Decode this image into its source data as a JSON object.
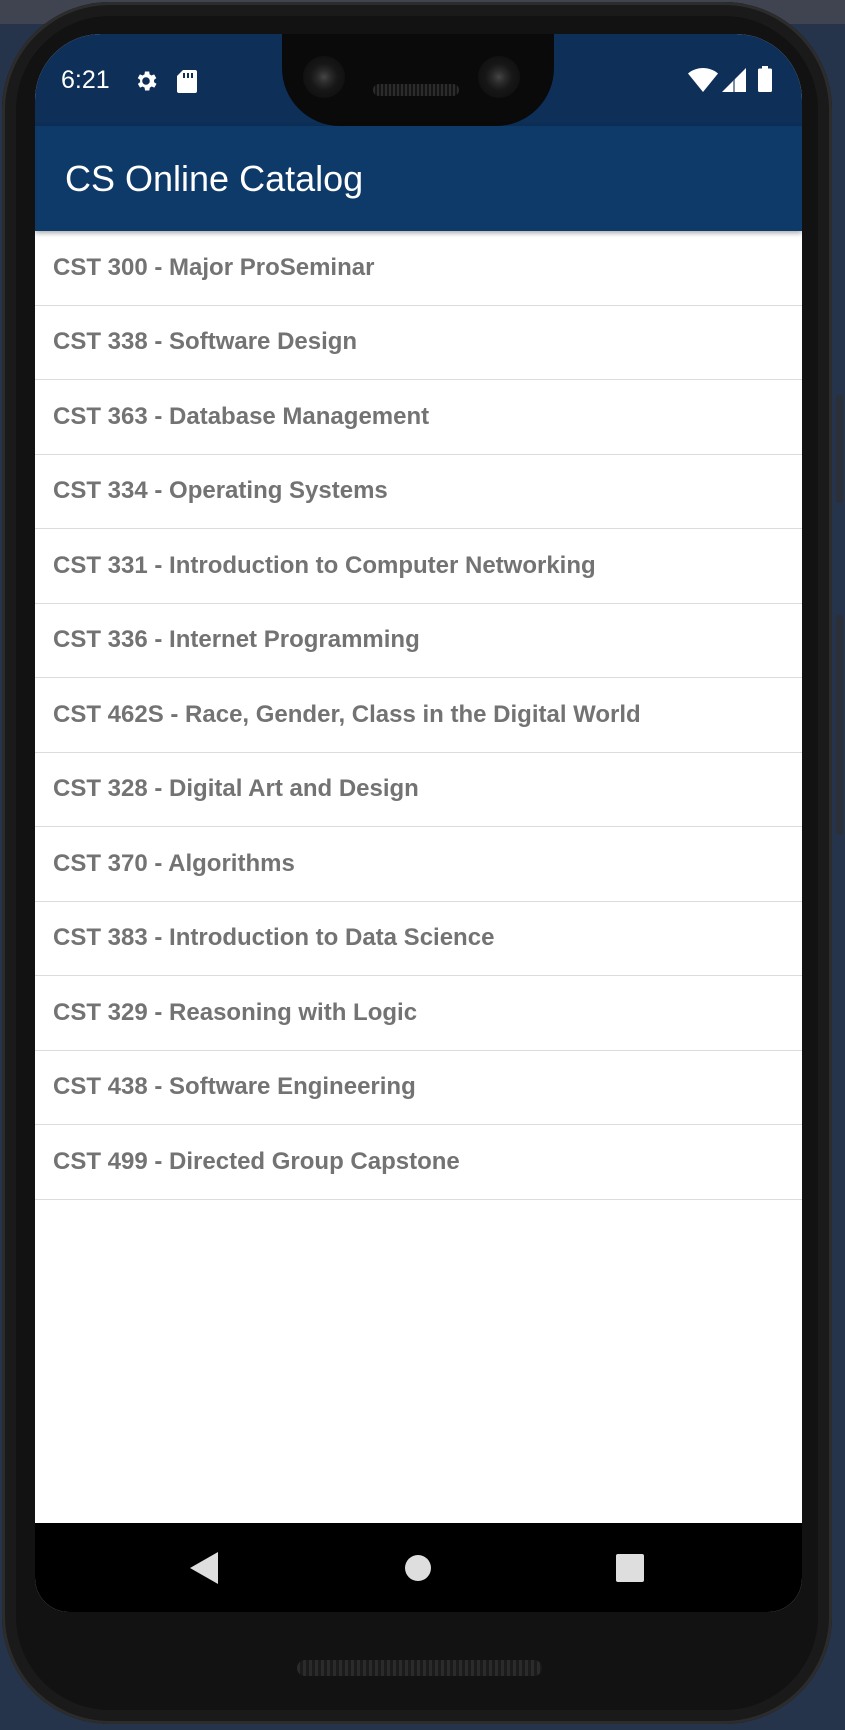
{
  "status_bar": {
    "time": "6:21",
    "left_icons": [
      "gear-icon",
      "sd-card-icon"
    ],
    "right_icons": [
      "wifi-icon",
      "signal-icon",
      "battery-icon"
    ]
  },
  "app_bar": {
    "title": "CS Online Catalog"
  },
  "courses": [
    {
      "label": "CST 300 - Major ProSeminar"
    },
    {
      "label": "CST 338 - Software Design"
    },
    {
      "label": "CST 363 - Database Management"
    },
    {
      "label": "CST 334 - Operating Systems"
    },
    {
      "label": "CST 331 - Introduction to Computer Networking"
    },
    {
      "label": "CST 336 - Internet Programming"
    },
    {
      "label": "CST 462S - Race, Gender, Class in the Digital World"
    },
    {
      "label": "CST 328 - Digital Art and Design"
    },
    {
      "label": "CST 370 - Algorithms"
    },
    {
      "label": "CST 383 - Introduction to Data Science"
    },
    {
      "label": "CST 329 - Reasoning with Logic"
    },
    {
      "label": "CST 438 - Software Engineering"
    },
    {
      "label": "CST 499 - Directed Group Capstone"
    }
  ],
  "nav_bar": {
    "buttons": [
      "back-icon",
      "home-icon",
      "recents-icon"
    ]
  },
  "colors": {
    "status_bar": "#0d2f58",
    "app_bar": "#0d3a68",
    "list_text": "#737373",
    "divider": "#dcdcdc"
  }
}
